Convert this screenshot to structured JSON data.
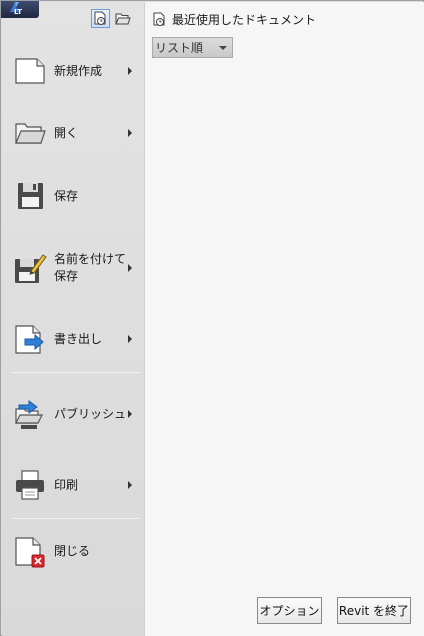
{
  "app": {
    "badge": "LT",
    "colors": {
      "accent_blue": "#2f7fd6",
      "close_red": "#d9262c"
    }
  },
  "view_toggles": [
    {
      "icon": "recent-documents-icon",
      "active": true
    },
    {
      "icon": "open-documents-icon",
      "active": false
    }
  ],
  "menu": {
    "items": [
      {
        "id": "new",
        "label": "新規作成",
        "icon": "new-document-icon",
        "submenu": true
      },
      {
        "id": "open",
        "label": "開く",
        "icon": "open-folder-icon",
        "submenu": true
      },
      {
        "id": "save",
        "label": "保存",
        "icon": "floppy-disk-icon",
        "submenu": false
      },
      {
        "id": "save-as",
        "label": "名前を付けて保存",
        "icon": "save-as-icon",
        "submenu": true
      },
      {
        "id": "export",
        "label": "書き出し",
        "icon": "export-icon",
        "submenu": true
      },
      {
        "id": "publish",
        "label": "パブリッシュ",
        "icon": "publish-icon",
        "submenu": true
      },
      {
        "id": "print",
        "label": "印刷",
        "icon": "printer-icon",
        "submenu": true
      },
      {
        "id": "close",
        "label": "閉じる",
        "icon": "close-document-icon",
        "submenu": false
      }
    ]
  },
  "recent": {
    "title": "最近使用したドキュメント",
    "sort": {
      "selected": "リスト順"
    }
  },
  "footer": {
    "options_label": "オプション",
    "exit_label": "Revit を終了"
  }
}
